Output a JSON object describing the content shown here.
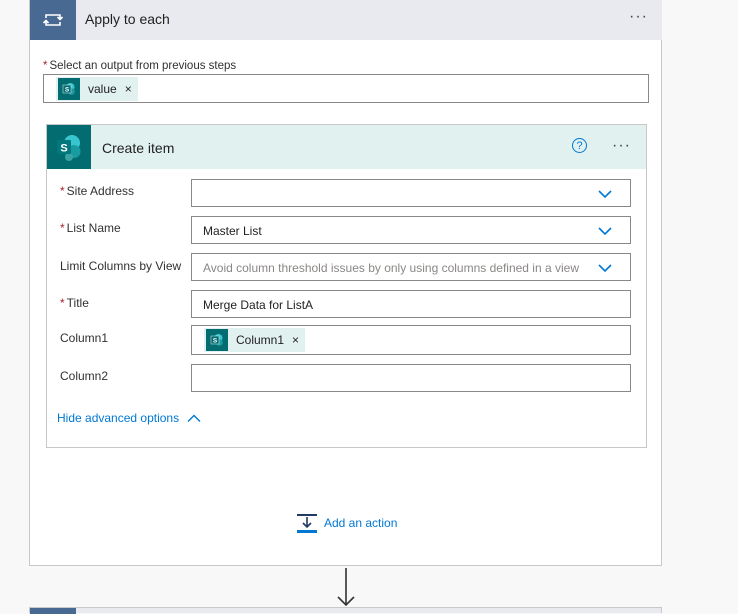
{
  "apply_to_each": {
    "title": "Apply to each",
    "more": "···",
    "select_label": "Select an output from previous steps",
    "required_mark": "*",
    "token": {
      "label": "value",
      "remove": "×"
    }
  },
  "create_item": {
    "title": "Create item",
    "help": "?",
    "more": "···",
    "fields": {
      "site_address": {
        "label": "Site Address",
        "required": "*",
        "value": ""
      },
      "list_name": {
        "label": "List Name",
        "required": "*",
        "value": "Master List"
      },
      "limit_columns": {
        "label": "Limit Columns by View",
        "placeholder": "Avoid column threshold issues by only using columns defined in a view"
      },
      "title": {
        "label": "Title",
        "required": "*",
        "value": "Merge Data for ListA"
      },
      "column1": {
        "label": "Column1",
        "token": "Column1",
        "remove": "×"
      },
      "column2": {
        "label": "Column2",
        "value": ""
      }
    },
    "hide_advanced": "Hide advanced options"
  },
  "add_action": "Add an action",
  "colors": {
    "loop_accent": "#486991",
    "sharepoint": "#036c70",
    "link": "#0078d4",
    "required": "#a4262c"
  },
  "icons": [
    "loop-icon",
    "sharepoint-icon",
    "help-icon",
    "chevron-down-icon",
    "chevron-up-icon",
    "add-action-icon",
    "arrow-down-icon"
  ]
}
